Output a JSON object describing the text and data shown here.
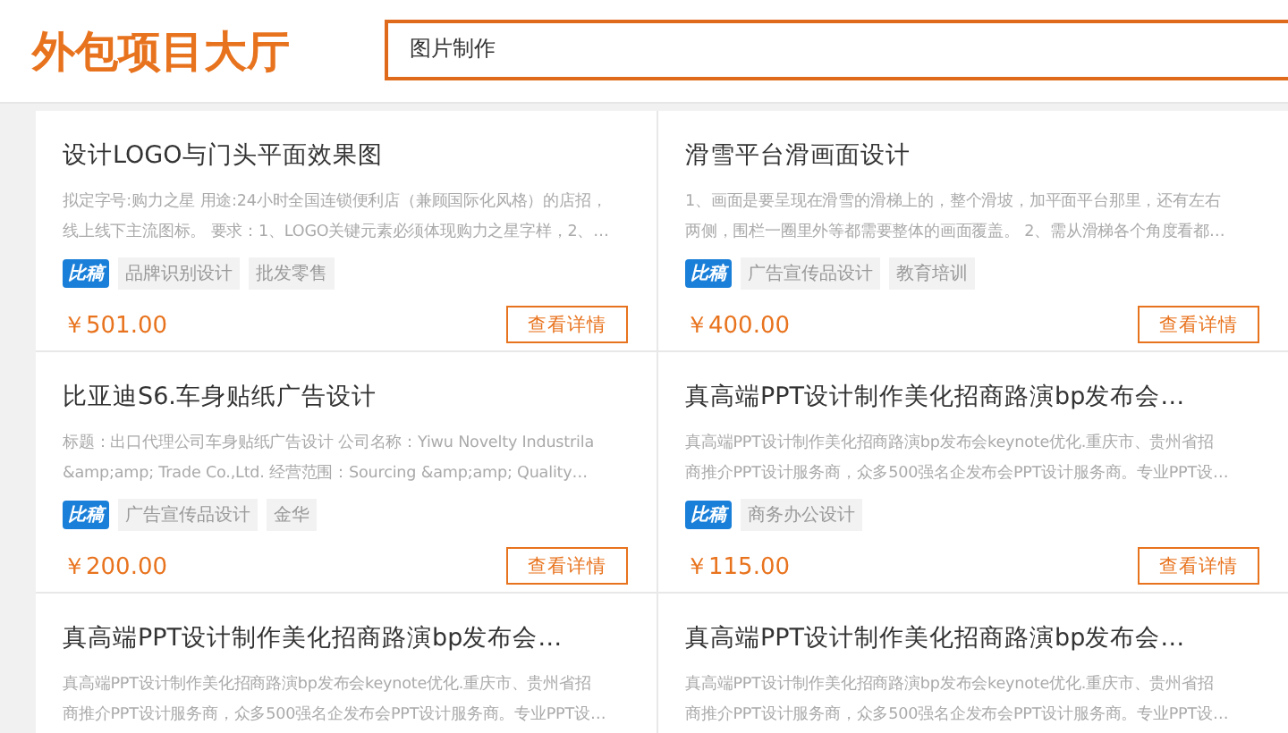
{
  "header": {
    "title": "外包项目大厅",
    "search": {
      "value": "图片制作"
    }
  },
  "projects": [
    {
      "title": "设计LOGO与门头平面效果图",
      "description": [
        "拟定字号:购力之星 用途:24小时全国连锁便利店（兼顾国际化风格）的店招，",
        "线上线下主流图标。 要求：1、LOGO关键元素必须体现购力之星字样，2、…"
      ],
      "badge": "比稿",
      "tags": [
        "品牌识别设计",
        "批发零售"
      ],
      "price": "￥501.00",
      "button": "查看详情"
    },
    {
      "title": "滑雪平台滑画面设计",
      "description": [
        "1、画面是要呈现在滑雪的滑梯上的，整个滑坡，加平面平台那里，还有左右",
        "两侧，围栏一圈里外等都需要整体的画面覆盖。 2、需从滑梯各个角度看都…"
      ],
      "badge": "比稿",
      "tags": [
        "广告宣传品设计",
        "教育培训"
      ],
      "price": "￥400.00",
      "button": "查看详情"
    },
    {
      "title": "比亚迪S6.车身贴纸广告设计",
      "description": [
        "标题：出口代理公司车身贴纸广告设计 公司名称：Yiwu Novelty Industrila",
        "&amp;amp; Trade Co.,Ltd. 经营范围：Sourcing &amp;amp; Quality…"
      ],
      "badge": "比稿",
      "tags": [
        "广告宣传品设计",
        "金华"
      ],
      "price": "￥200.00",
      "button": "查看详情"
    },
    {
      "title": "真高端PPT设计制作美化招商路演bp发布会…",
      "description": [
        "真高端PPT设计制作美化招商路演bp发布会keynote优化.重庆市、贵州省招",
        "商推介PPT设计服务商，众多500强名企发布会PPT设计服务商。专业PPT设…"
      ],
      "badge": "比稿",
      "tags": [
        "商务办公设计"
      ],
      "price": "￥115.00",
      "button": "查看详情"
    },
    {
      "title": "真高端PPT设计制作美化招商路演bp发布会…",
      "description": [
        "真高端PPT设计制作美化招商路演bp发布会keynote优化.重庆市、贵州省招",
        "商推介PPT设计服务商，众多500强名企发布会PPT设计服务商。专业PPT设…"
      ]
    },
    {
      "title": "真高端PPT设计制作美化招商路演bp发布会…",
      "description": [
        "真高端PPT设计制作美化招商路演bp发布会keynote优化.重庆市、贵州省招",
        "商推介PPT设计服务商，众多500强名企发布会PPT设计服务商。专业PPT设…"
      ]
    }
  ]
}
